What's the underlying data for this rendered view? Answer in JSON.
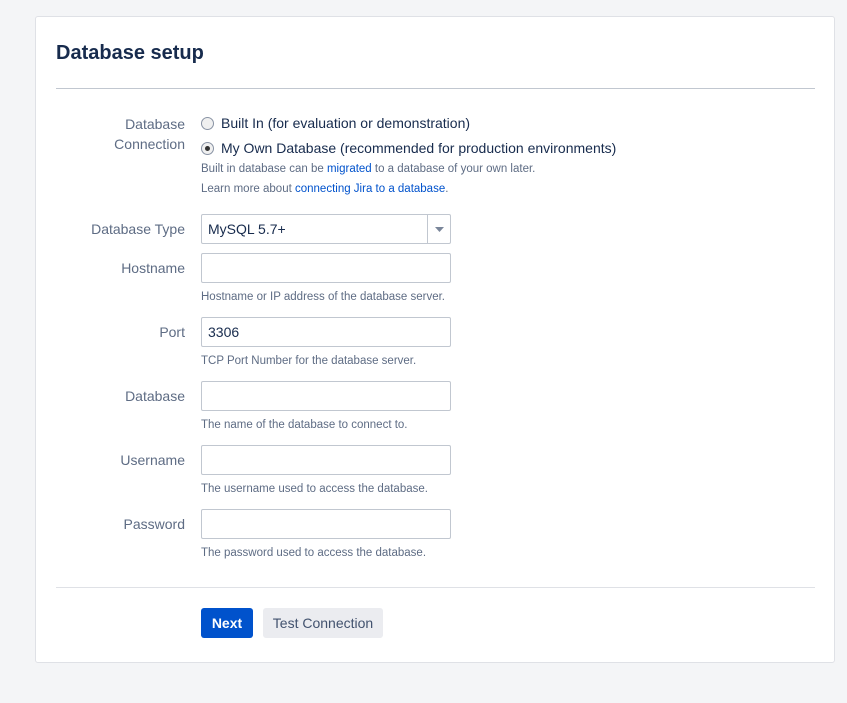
{
  "page": {
    "title": "Database setup"
  },
  "connection": {
    "label_line1": "Database",
    "label_line2": "Connection",
    "options": [
      {
        "label": "Built In (for evaluation or demonstration)",
        "checked": false
      },
      {
        "label": "My Own Database (recommended for production environments)",
        "checked": true
      }
    ],
    "help1_pre": "Built in database can be ",
    "help1_link": "migrated",
    "help1_post": " to a database of your own later.",
    "help2_pre": "Learn more about ",
    "help2_link": "connecting Jira to a database",
    "help2_post": "."
  },
  "db_type": {
    "label": "Database Type",
    "value": "MySQL 5.7+"
  },
  "hostname": {
    "label": "Hostname",
    "value": "",
    "help": "Hostname or IP address of the database server."
  },
  "port": {
    "label": "Port",
    "value": "3306",
    "help": "TCP Port Number for the database server."
  },
  "database": {
    "label": "Database",
    "value": "",
    "help": "The name of the database to connect to."
  },
  "username": {
    "label": "Username",
    "value": "",
    "help": "The username used to access the database."
  },
  "password": {
    "label": "Password",
    "value": "",
    "help": "The password used to access the database."
  },
  "actions": {
    "next_label": "Next",
    "test_label": "Test Connection"
  },
  "colors": {
    "primary": "#0052cc",
    "link": "#0052cc",
    "text": "#172b4d",
    "subtle": "#5e6c84"
  }
}
